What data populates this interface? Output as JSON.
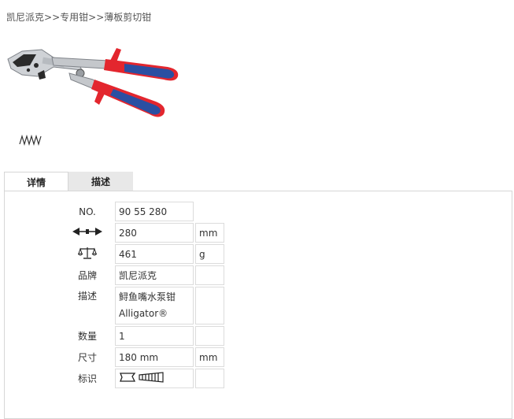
{
  "breadcrumb": {
    "brand": "凯尼派克",
    "sep1": ">>",
    "category": "专用钳",
    "sep2": ">>",
    "product": "薄板剪切钳"
  },
  "colors": {
    "handle_red": "#e3262e",
    "handle_blue": "#2a4fa2",
    "tab_inactive": "#e8e8e8",
    "border": "#d6d6d6"
  },
  "icons": {
    "cut_profile": "zigzag-cut-icon",
    "length": "double-arrow-icon",
    "weight": "balance-scale-icon",
    "marking": "jaw-profile-icon"
  },
  "tabs": [
    {
      "label": "详情"
    },
    {
      "label": "描述"
    }
  ],
  "specs": {
    "no": {
      "label": "NO.",
      "value": "90 55 280"
    },
    "length": {
      "value": "280",
      "unit": "mm"
    },
    "weight": {
      "value": "461",
      "unit": "g"
    },
    "brand": {
      "label": "品牌",
      "value": "凯尼派克"
    },
    "description": {
      "label": "描述",
      "value_line1": "鲟鱼嘴水泵钳",
      "value_line2": "Alligator®"
    },
    "quantity": {
      "label": "数量",
      "value": "1"
    },
    "size": {
      "label": "尺寸",
      "value": "180 mm",
      "unit": "mm"
    },
    "marking": {
      "label": "标识"
    }
  }
}
